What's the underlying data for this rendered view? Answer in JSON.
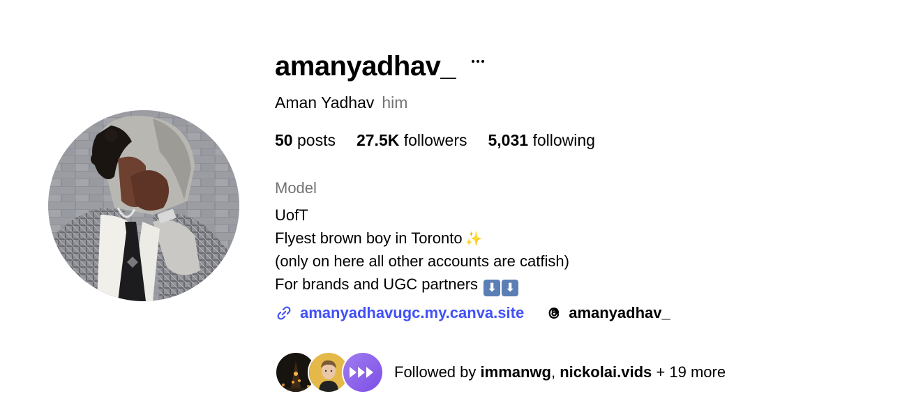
{
  "profile": {
    "username": "amanyadhav_",
    "full_name": "Aman Yadhav",
    "pronouns": "him",
    "avatar_icon": "profile-photo"
  },
  "stats": {
    "posts_count": "50",
    "posts_label": "posts",
    "followers_count": "27.5K",
    "followers_label": "followers",
    "following_count": "5,031",
    "following_label": "following"
  },
  "bio": {
    "category": "Model",
    "lines": [
      "UofT",
      "Flyest brown boy in Toronto",
      "(only on here all other accounts are catfish)",
      "For brands and UGC partners"
    ],
    "sparkle_emoji": "✨",
    "down_arrow_emoji": "⬇"
  },
  "links": {
    "website": "amanyadhavugc.my.canva.site",
    "website_icon": "link-icon",
    "threads": "amanyadhav_",
    "threads_icon": "threads-icon",
    "link_color": "#4150f7"
  },
  "followed_by": {
    "prefix": "Followed by",
    "user1": "immanwg",
    "separator": ",",
    "user2": "nickolai.vids",
    "more": "+ 19 more"
  },
  "colors": {
    "secondary_text": "#737373",
    "accent_purple": "#8b5cf6"
  }
}
